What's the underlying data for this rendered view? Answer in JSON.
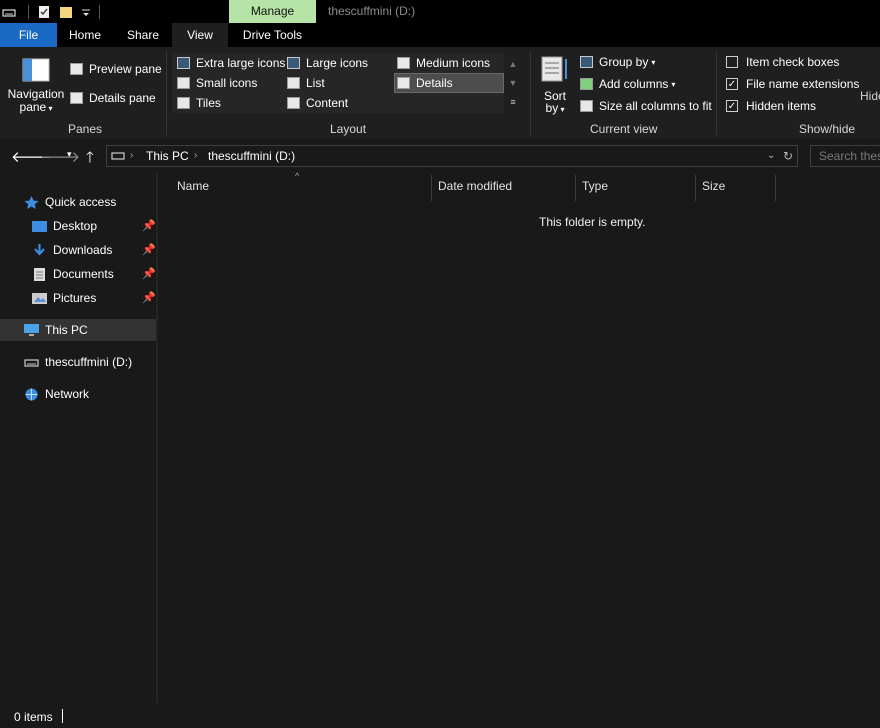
{
  "titlebar": {
    "context_tab": "Manage",
    "window_title": "thescuffmini (D:)"
  },
  "tabs": {
    "file": "File",
    "home": "Home",
    "share": "Share",
    "view": "View",
    "drive_tools": "Drive Tools"
  },
  "ribbon": {
    "panes": {
      "label": "Panes",
      "navigation_pane_1": "Navigation",
      "navigation_pane_2": "pane",
      "preview_pane": "Preview pane",
      "details_pane": "Details pane"
    },
    "layout": {
      "label": "Layout",
      "extra_large_icons": "Extra large icons",
      "large_icons": "Large icons",
      "medium_icons": "Medium icons",
      "small_icons": "Small icons",
      "list": "List",
      "details": "Details",
      "tiles": "Tiles",
      "content": "Content"
    },
    "current_view": {
      "label": "Current view",
      "sort_by_1": "Sort",
      "sort_by_2": "by",
      "group_by": "Group by",
      "add_columns": "Add columns",
      "size_all_columns": "Size all columns to fit"
    },
    "show_hide": {
      "label": "Show/hide",
      "item_check_boxes": "Item check boxes",
      "file_name_extensions": "File name extensions",
      "hidden_items": "Hidden items",
      "hide_selected": "Hide",
      "item_check_boxes_checked": false,
      "file_name_extensions_checked": true,
      "hidden_items_checked": true
    }
  },
  "address": {
    "crumbs": [
      "This PC",
      "thescuffmini (D:)"
    ],
    "search_placeholder": "Search thes"
  },
  "nav": {
    "quick_access": "Quick access",
    "desktop": "Desktop",
    "downloads": "Downloads",
    "documents": "Documents",
    "pictures": "Pictures",
    "this_pc": "This PC",
    "drive": "thescuffmini (D:)",
    "network": "Network"
  },
  "columns": {
    "name": "Name",
    "date_modified": "Date modified",
    "type": "Type",
    "size": "Size"
  },
  "content": {
    "empty_message": "This folder is empty."
  },
  "status": {
    "item_count": "0 items"
  },
  "colors": {
    "file_tab": "#1a69c4",
    "manage_tab": "#b6e3a6",
    "background": "#191919"
  }
}
